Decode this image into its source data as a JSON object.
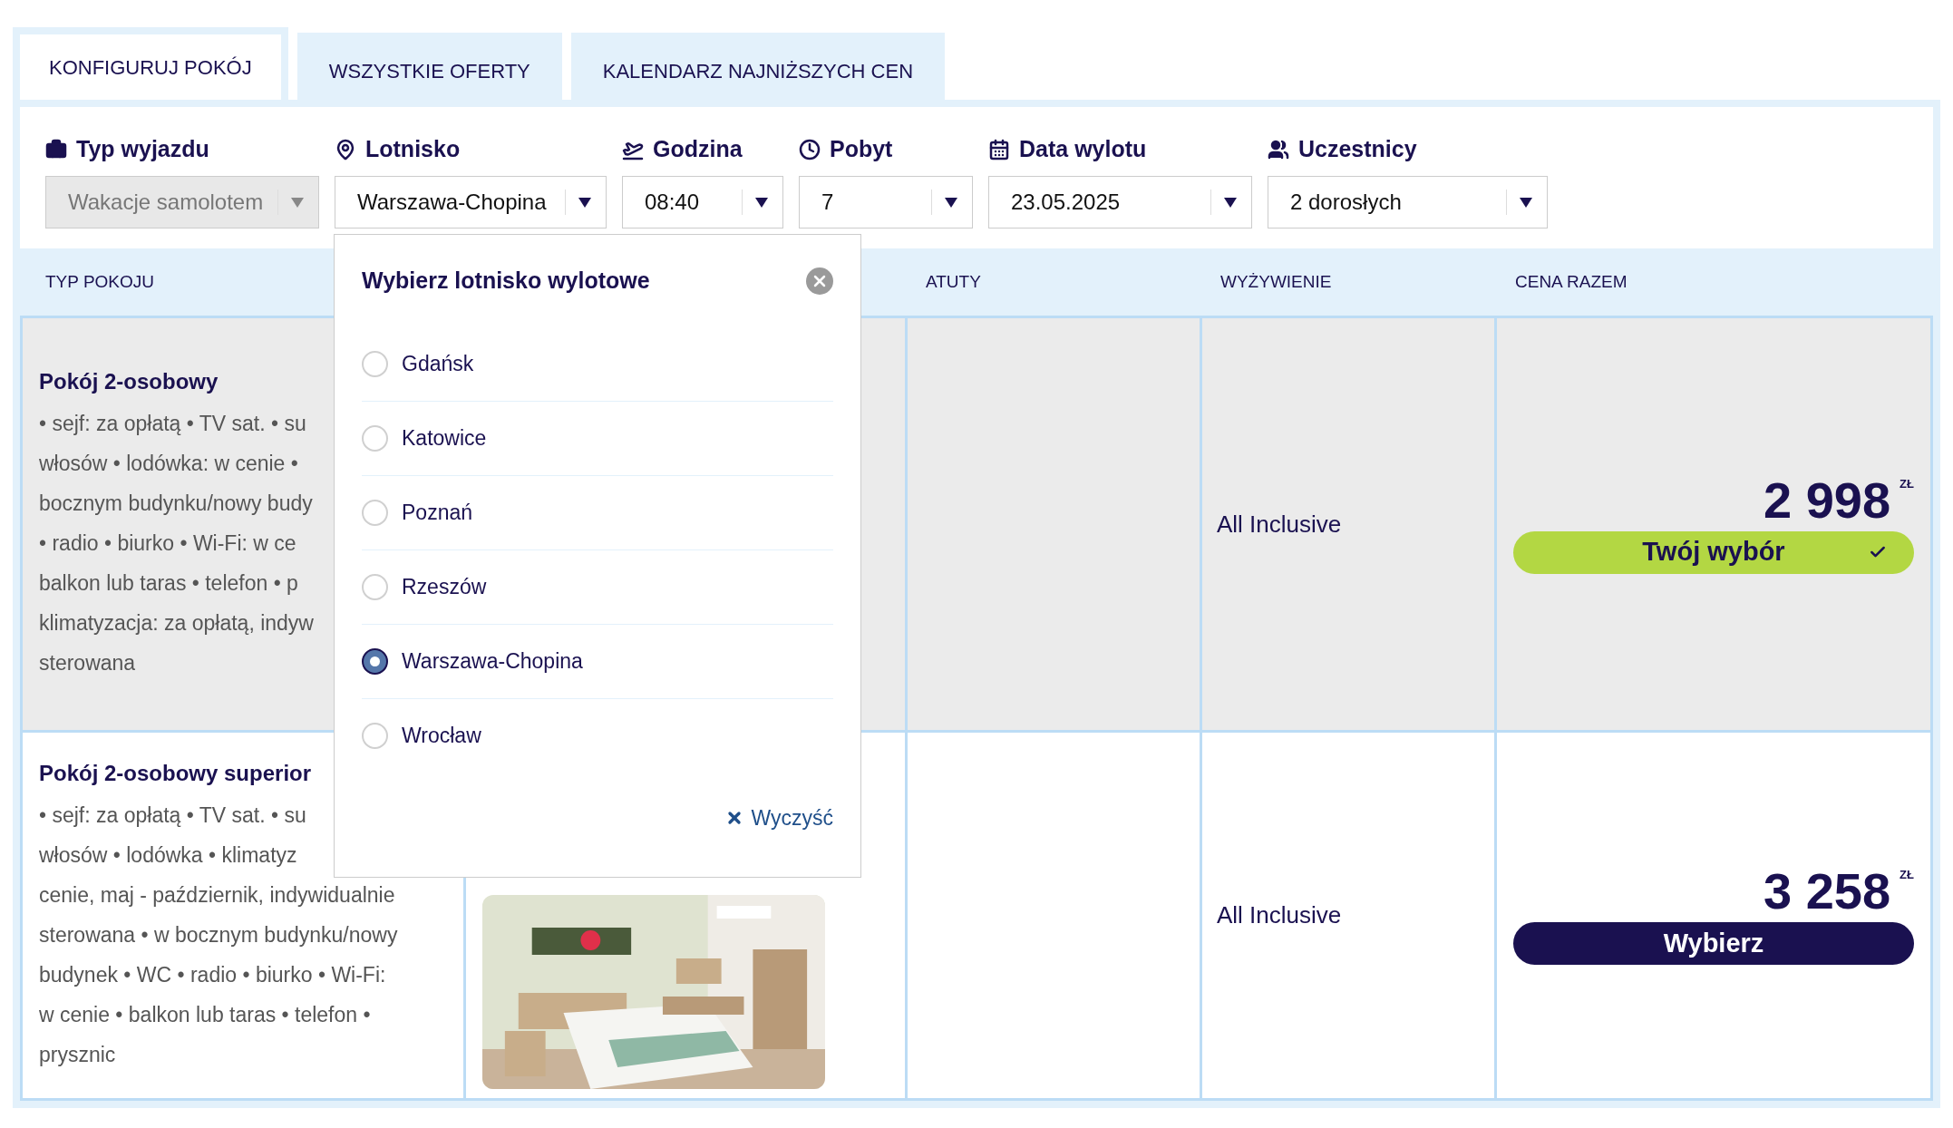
{
  "tabs": [
    {
      "label": "KONFIGURUJ POKÓJ",
      "selected": true
    },
    {
      "label": "WSZYSTKIE OFERTY",
      "selected": false
    },
    {
      "label": "KALENDARZ NAJNIŻSZYCH CEN",
      "selected": false
    }
  ],
  "filters": [
    {
      "label": "Typ wyjazdu",
      "value": "Wakacje samolotem",
      "disabled": true
    },
    {
      "label": "Lotnisko",
      "value": "Warszawa-Chopina",
      "disabled": false
    },
    {
      "label": "Godzina",
      "value": "08:40",
      "disabled": false
    },
    {
      "label": "Pobyt",
      "value": "7",
      "disabled": false
    },
    {
      "label": "Data wylotu",
      "value": "23.05.2025",
      "disabled": false
    },
    {
      "label": "Uczestnicy",
      "value": "2 dorosłych",
      "disabled": false
    }
  ],
  "table": {
    "columns": [
      {
        "label": "TYP POKOJU"
      },
      {
        "label": "ATUTY"
      },
      {
        "label": "WYŻYWIENIE"
      },
      {
        "label": "CENA RAZEM"
      }
    ],
    "rows": [
      {
        "title": "Pokój 2-osobowy",
        "description_lines": [
          "• sejf: za opłatą • TV sat. • su",
          "włosów • lodówka: w cenie •",
          "bocznym budynku/nowy budy",
          "• radio • biurko • Wi-Fi: w ce",
          "balkon lub taras • telefon • p",
          "klimatyzacja: za opłatą, indyw",
          "sterowana"
        ],
        "board": "All Inclusive",
        "price": "2 998",
        "currency": "ZŁ",
        "button": {
          "label": "Twój wybór",
          "selected": true
        }
      },
      {
        "title": "Pokój 2-osobowy superior",
        "description_lines": [
          "• sejf: za opłatą • TV sat. • su",
          "włosów • lodówka • klimatyz",
          "cenie, maj - październik, indywidualnie",
          "sterowana • w bocznym budynku/nowy",
          "budynek • WC • radio • biurko • Wi-Fi:",
          "w cenie • balkon lub taras • telefon •",
          "prysznic"
        ],
        "board": "All Inclusive",
        "price": "3 258",
        "currency": "ZŁ",
        "button": {
          "label": "Wybierz",
          "selected": false
        }
      }
    ]
  },
  "airport_popup": {
    "title": "Wybierz lotnisko wylotowe",
    "options": [
      {
        "label": "Gdańsk",
        "selected": false
      },
      {
        "label": "Katowice",
        "selected": false
      },
      {
        "label": "Poznań",
        "selected": false
      },
      {
        "label": "Rzeszów",
        "selected": false
      },
      {
        "label": "Warszawa-Chopina",
        "selected": true
      },
      {
        "label": "Wrocław",
        "selected": false
      }
    ],
    "clear": "Wyczyść"
  }
}
